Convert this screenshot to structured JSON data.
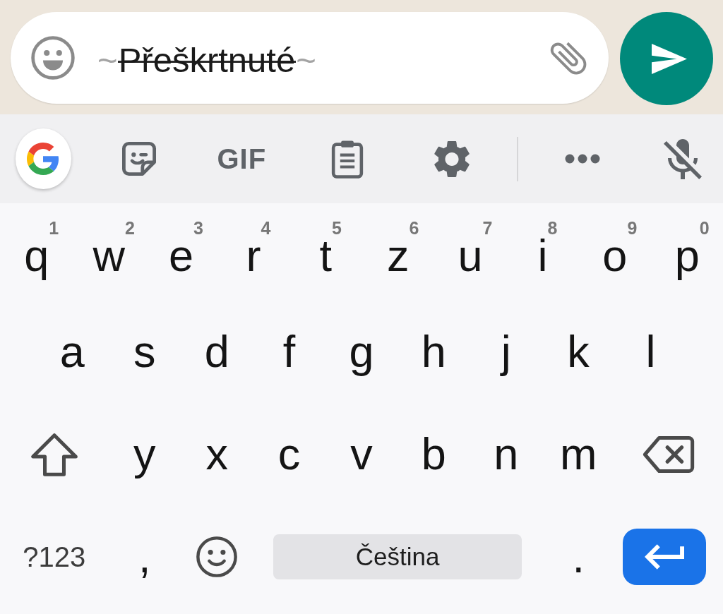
{
  "composer": {
    "message": {
      "marker_open": "~",
      "text": "Přeškrtnuté",
      "marker_close": "~",
      "strikethrough": true
    }
  },
  "suggestion_strip": {
    "gif_label": "GIF"
  },
  "keyboard": {
    "rows": [
      {
        "keys": [
          {
            "kind": "letter",
            "label": "q",
            "hint": "1"
          },
          {
            "kind": "letter",
            "label": "w",
            "hint": "2"
          },
          {
            "kind": "letter",
            "label": "e",
            "hint": "3"
          },
          {
            "kind": "letter",
            "label": "r",
            "hint": "4"
          },
          {
            "kind": "letter",
            "label": "t",
            "hint": "5"
          },
          {
            "kind": "letter",
            "label": "z",
            "hint": "6"
          },
          {
            "kind": "letter",
            "label": "u",
            "hint": "7"
          },
          {
            "kind": "letter",
            "label": "i",
            "hint": "8"
          },
          {
            "kind": "letter",
            "label": "o",
            "hint": "9"
          },
          {
            "kind": "letter",
            "label": "p",
            "hint": "0"
          }
        ]
      },
      {
        "keys": [
          {
            "kind": "letter",
            "label": "a"
          },
          {
            "kind": "letter",
            "label": "s"
          },
          {
            "kind": "letter",
            "label": "d"
          },
          {
            "kind": "letter",
            "label": "f"
          },
          {
            "kind": "letter",
            "label": "g"
          },
          {
            "kind": "letter",
            "label": "h"
          },
          {
            "kind": "letter",
            "label": "j"
          },
          {
            "kind": "letter",
            "label": "k"
          },
          {
            "kind": "letter",
            "label": "l"
          }
        ]
      },
      {
        "keys": [
          {
            "kind": "shift"
          },
          {
            "kind": "letter",
            "label": "y"
          },
          {
            "kind": "letter",
            "label": "x"
          },
          {
            "kind": "letter",
            "label": "c"
          },
          {
            "kind": "letter",
            "label": "v"
          },
          {
            "kind": "letter",
            "label": "b"
          },
          {
            "kind": "letter",
            "label": "n"
          },
          {
            "kind": "letter",
            "label": "m"
          },
          {
            "kind": "backspace"
          }
        ]
      },
      {
        "keys": [
          {
            "kind": "symbols",
            "label": "?123"
          },
          {
            "kind": "letter",
            "label": ","
          },
          {
            "kind": "emoji"
          },
          {
            "kind": "space",
            "label": "Čeština"
          },
          {
            "kind": "letter",
            "label": "."
          },
          {
            "kind": "enter"
          }
        ]
      }
    ]
  }
}
